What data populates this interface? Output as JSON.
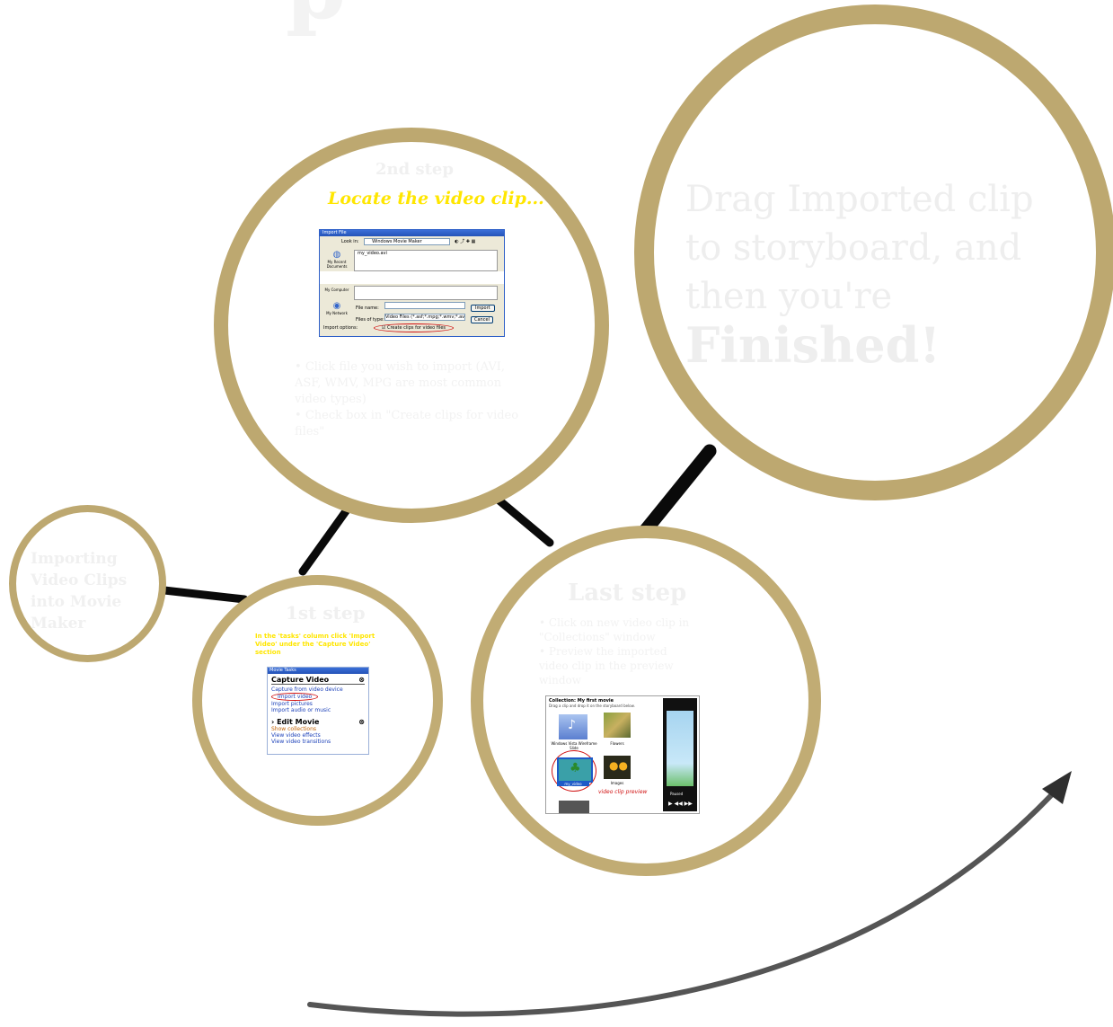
{
  "colors": {
    "ring": "#bda870",
    "ring_light": "#d6c797",
    "connector": "#0a0a0a",
    "accent_yellow": "#ffe600",
    "pale_text": "#efefef",
    "arrow": "#4a4a4a"
  },
  "intro": {
    "title": "Importing Video Clips into Movie Maker"
  },
  "step1": {
    "heading": "1st step",
    "instruction": "In the 'tasks' column click 'Import Video' under the 'Capture Video' section",
    "panel": {
      "title": "Movie Tasks",
      "section1": "Capture Video",
      "links": [
        "Capture from video device",
        "Import video",
        "Import pictures",
        "Import audio or music"
      ],
      "section2": "Edit Movie",
      "links2": [
        "Show collections",
        "View video effects",
        "View video transitions"
      ]
    }
  },
  "step2": {
    "heading": "2nd step",
    "subtitle": "Locate the video clip...",
    "dialog": {
      "title": "Import File",
      "look_in_label": "Look in:",
      "look_in_value": "Windows Movie Maker",
      "file_entry": "my_video.avi",
      "file_name_label": "File name:",
      "files_type_label": "Files of type:",
      "files_type_value": "Video Files (*.asf;*.mpg;*.wmv;*.avi)",
      "import_button": "Import",
      "cancel_button": "Cancel",
      "import_options_label": "Import options:",
      "checkbox_label": "Create clips for video files",
      "sidebar": [
        "My Recent Documents",
        "My Computer",
        "My Network"
      ]
    },
    "bullets": [
      "Click file you wish to import (AVI, ASF, WMV, MPG are most common video types)",
      "Check box in \"Create clips for video files\""
    ]
  },
  "last_step": {
    "heading": "Last step",
    "bullets": [
      "Click on new video clip in \"Collections\" window",
      "Preview the imported video clip in the preview window"
    ],
    "collections": {
      "header": "Collection: My first movie",
      "hint": "Drag a clip and drop it on the storyboard below.",
      "items": [
        "Windows Vista Wireframe Slide",
        "Flowers",
        "my_video",
        "Images"
      ],
      "annotation": "video clip preview",
      "preview_status": "Paused"
    }
  },
  "final": {
    "text": "Drag Imported clip to storyboard, and then you're",
    "emphasis": "Finished!"
  }
}
